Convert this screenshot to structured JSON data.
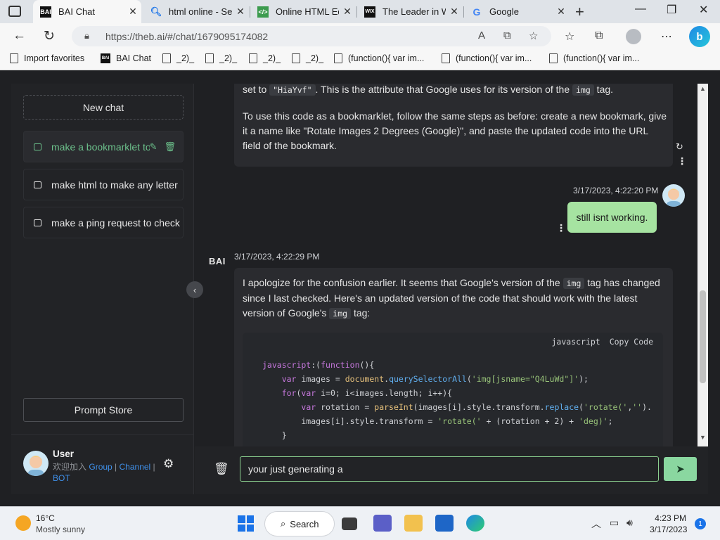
{
  "browser": {
    "tabs": [
      {
        "title": "BAI Chat",
        "favicon": "BAI",
        "active": true
      },
      {
        "title": "html online - Sea",
        "favicon": "search-icon",
        "active": false
      },
      {
        "title": "Online HTML Edit",
        "favicon": "html-icon",
        "active": false
      },
      {
        "title": "The Leader in We",
        "favicon": "WIX",
        "active": false
      },
      {
        "title": "Google",
        "favicon": "G",
        "active": false
      }
    ],
    "url": "https://theb.ai/#/chat/1679095174082",
    "favorites": [
      {
        "label": "Import favorites",
        "icon": "import-icon"
      },
      {
        "label": "BAI Chat",
        "icon": "BAI"
      },
      {
        "label": "_2)_",
        "icon": "page-icon"
      },
      {
        "label": "_2)_",
        "icon": "page-icon"
      },
      {
        "label": "_2)_",
        "icon": "page-icon"
      },
      {
        "label": "_2)_",
        "icon": "page-icon"
      },
      {
        "label": "(function(){  var im...",
        "icon": "page-icon"
      },
      {
        "label": "(function(){  var im...",
        "icon": "page-icon"
      },
      {
        "label": "(function(){  var im...",
        "icon": "page-icon"
      }
    ]
  },
  "sidebar": {
    "new_chat": "New chat",
    "conversations": [
      {
        "title": "make a bookmarklet to rotate images",
        "active": true
      },
      {
        "title": "make html to make any letter",
        "active": false
      },
      {
        "title": "make a ping request to check",
        "active": false
      }
    ],
    "prompt_store": "Prompt Store",
    "user": {
      "name": "User",
      "join_text": "欢迎加入",
      "group_link": "Group",
      "sep1": " | ",
      "channel_link": "Channel",
      "sep2": " | ",
      "bot_link": "BOT"
    }
  },
  "chat": {
    "msg1": {
      "line1_a": "set to ",
      "line1_code": "\"HiaYvf\"",
      "line1_b": ". This is the attribute that Google uses for its version of the ",
      "line1_code2": "img",
      "line1_c": " tag.",
      "para2": "To use this code as a bookmarklet, follow the same steps as before: create a new bookmark, give it a name like \"Rotate Images 2 Degrees (Google)\", and paste the updated code into the URL field of the bookmark."
    },
    "user_msg": {
      "timestamp": "3/17/2023, 4:22:20 PM",
      "text": "still isnt working."
    },
    "msg2": {
      "sender": "BAI",
      "timestamp": "3/17/2023, 4:22:29 PM",
      "text_a": "I apologize for the confusion earlier. It seems that Google's version of the ",
      "code1": "img",
      "text_b": " tag has changed since I last checked. Here's an updated version of the code that should work with the latest version of Google's ",
      "code2": "img",
      "text_c": " tag:",
      "code_lang": "javascript",
      "copy_label": "Copy Code"
    },
    "input_value": "your just generating a",
    "colors": {
      "accent": "#6cc08b",
      "user_bubble": "#a6e3a1",
      "send": "#8ad7a0"
    }
  },
  "taskbar": {
    "temp": "16°C",
    "weather": "Mostly sunny",
    "search": "Search",
    "time": "4:23 PM",
    "date": "3/17/2023",
    "notifications": "1"
  }
}
